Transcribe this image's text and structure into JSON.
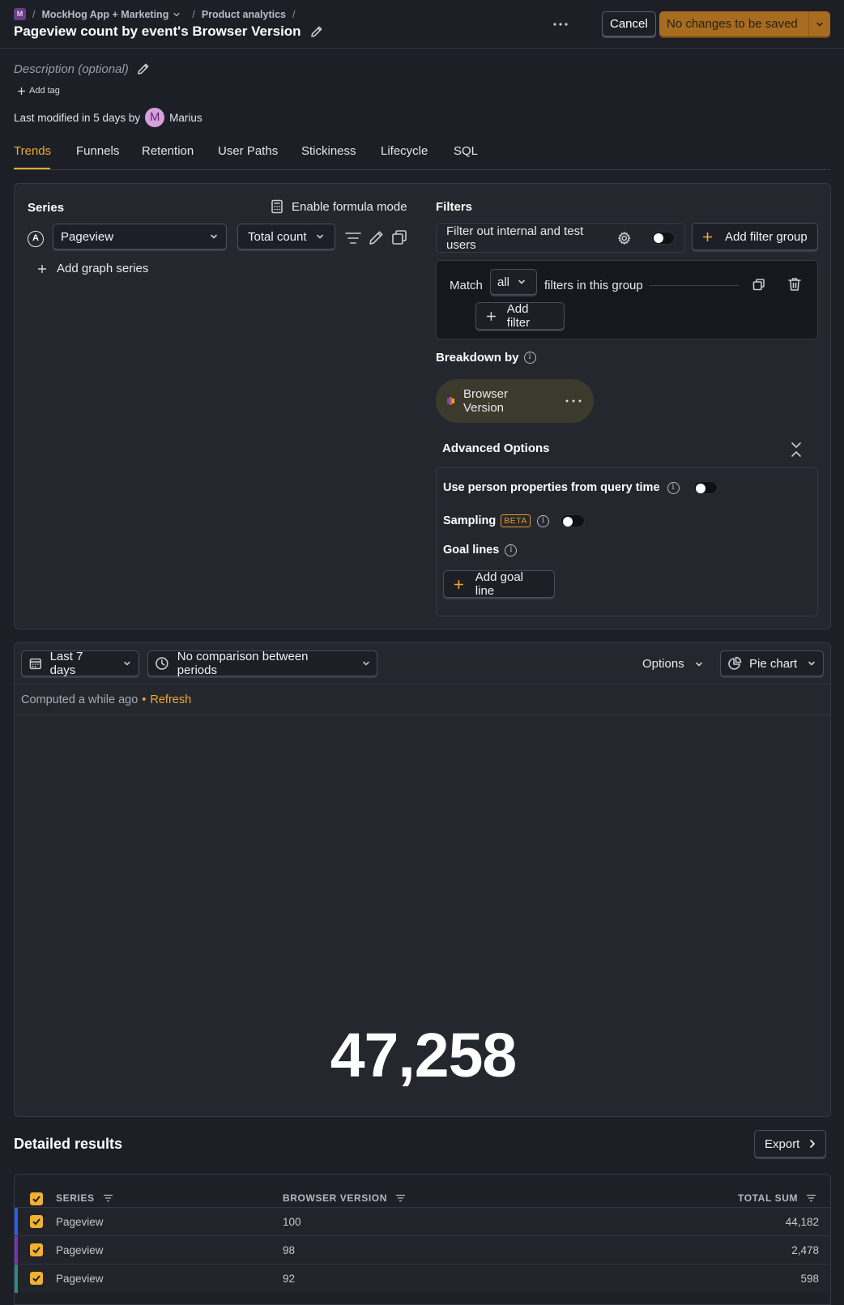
{
  "colors": {
    "accent": "#f1a82c",
    "save_button_bg": "#a76c1f",
    "series_colors": [
      "#2a5df0",
      "#7a2fb8",
      "#2e8b82"
    ]
  },
  "breadcrumb": {
    "project_badge": "M",
    "project": "MockHog App + Marketing",
    "section": "Product analytics"
  },
  "header": {
    "title": "Pageview count by event's Browser Version",
    "cancel_label": "Cancel",
    "save_label": "No changes to be saved"
  },
  "meta": {
    "description_placeholder": "Description (optional)",
    "add_tag_label": "Add tag",
    "last_modified_prefix": "Last modified in 5 days by",
    "avatar_letter": "M",
    "author": "Marius"
  },
  "tabs": [
    "Trends",
    "Funnels",
    "Retention",
    "User Paths",
    "Stickiness",
    "Lifecycle",
    "SQL"
  ],
  "series": {
    "title": "Series",
    "formula_mode_label": "Enable formula mode",
    "letter": "A",
    "event": "Pageview",
    "math": "Total count",
    "add_series_label": "Add graph series"
  },
  "filters": {
    "title": "Filters",
    "internal_users_label": "Filter out internal and test users",
    "add_group_label": "Add filter group",
    "match_label": "Match",
    "match_value": "all",
    "group_suffix": "filters in this group",
    "add_filter_label": "Add filter"
  },
  "breakdown": {
    "title": "Breakdown by",
    "property": "Browser Version"
  },
  "advanced": {
    "title": "Advanced Options",
    "person_props_label": "Use person properties from query time",
    "sampling_label": "Sampling",
    "beta_badge": "BETA",
    "goal_lines_label": "Goal lines",
    "add_goal_label": "Add goal line"
  },
  "results": {
    "date_range": "Last 7 days",
    "comparison": "No comparison between periods",
    "options_label": "Options",
    "chart_type": "Pie chart",
    "computed_text": "Computed a while ago",
    "bullet": "•",
    "refresh_label": "Refresh",
    "big_number": "47,258"
  },
  "detailed": {
    "title": "Detailed results",
    "export_label": "Export",
    "columns": [
      "SERIES",
      "BROWSER VERSION",
      "TOTAL SUM"
    ],
    "rows": [
      {
        "series": "Pageview",
        "version": "100",
        "total": "44,182"
      },
      {
        "series": "Pageview",
        "version": "98",
        "total": "2,478"
      },
      {
        "series": "Pageview",
        "version": "92",
        "total": "598"
      }
    ]
  }
}
